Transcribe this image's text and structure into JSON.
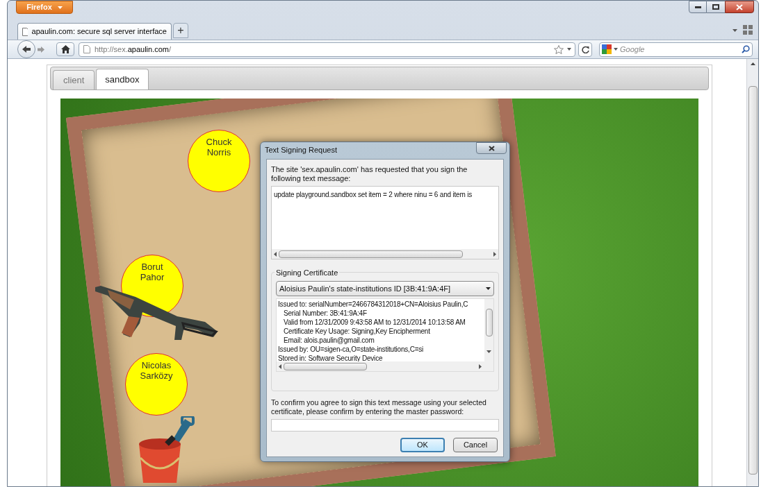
{
  "browser": {
    "menu_button": "Firefox",
    "tabs": [
      {
        "title": "apaulin.com: secure sql server interface",
        "selected": true
      }
    ],
    "new_tab": "+",
    "url": {
      "scheme": "http://sex.",
      "domain": "apaulin.com",
      "path": "/"
    },
    "search_placeholder": "Google"
  },
  "page": {
    "tabs": [
      {
        "label": "client",
        "selected": false
      },
      {
        "label": "sandbox",
        "selected": true
      }
    ],
    "sandbox": {
      "people": [
        {
          "name": "Chuck Norris",
          "kind": "plain"
        },
        {
          "name": "Borut Pahor",
          "kind": "rifle"
        },
        {
          "name": "Nicolas Sarközy",
          "kind": "bucket"
        }
      ]
    }
  },
  "dialog": {
    "title": "Text Signing Request",
    "intro": "The site 'sex.apaulin.com' has requested that you sign the following text message:",
    "message": "update playground.sandbox set item = 2 where ninu = 6 and item is",
    "certificate_group": "Signing Certificate",
    "certificate": "Aloisius Paulin's state-institutions ID [3B:41:9A:4F]",
    "details": [
      {
        "text": "Issued to: serialNumber=2466784312018+CN=Aloisius Paulin,C",
        "children": [
          {
            "text": "Serial Number: 3B:41:9A:4F"
          },
          {
            "text": "Valid from 12/31/2009 9:43:58 AM to 12/31/2014 10:13:58 AM"
          },
          {
            "text": "Certificate Key Usage: Signing,Key Encipherment"
          },
          {
            "text": "Email: alois.paulin@gmail.com"
          }
        ]
      },
      {
        "text": "Issued by: OU=sigen-ca,O=state-institutions,C=si"
      },
      {
        "text": "Stored in: Software Security Device"
      }
    ],
    "confirm_text": "To confirm you agree to sign this text message using your selected certificate, please confirm by entering the master password:",
    "buttons": [
      {
        "label": "OK",
        "default": true
      },
      {
        "label": "Cancel",
        "default": false
      }
    ]
  }
}
